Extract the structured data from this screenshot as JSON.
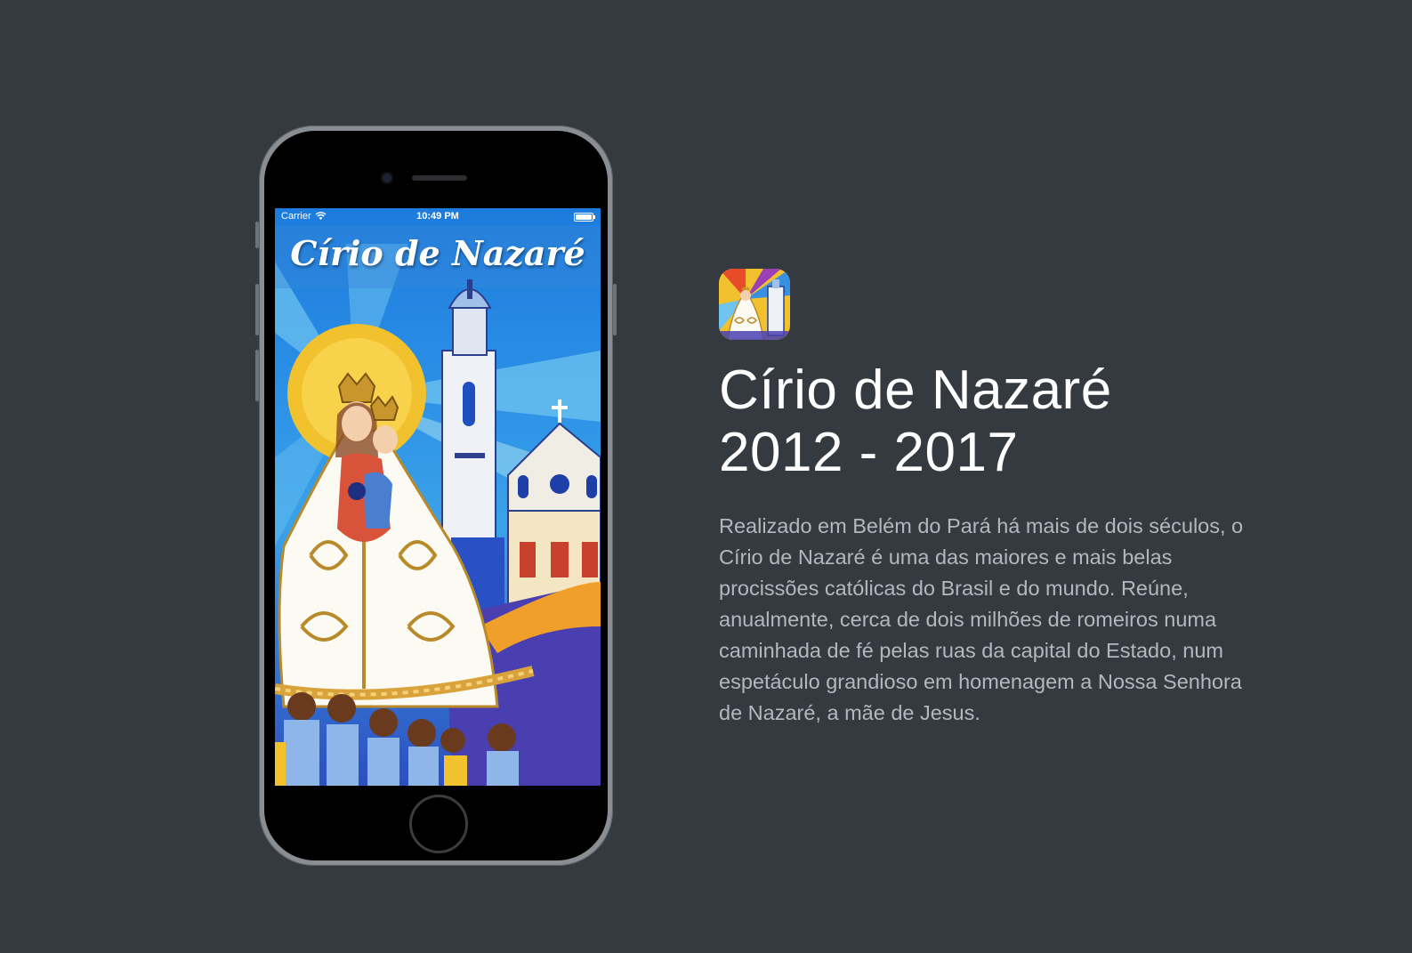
{
  "device": {
    "status_bar": {
      "carrier": "Carrier",
      "time": "10:49 PM"
    },
    "app_title": "Círio de Nazaré"
  },
  "app_icon_name": "cirio-de-nazare-app-icon",
  "heading": {
    "line1": "Círio de Nazaré",
    "line2": "2012 - 2017"
  },
  "description": "Realizado em Belém do Pará há mais de dois séculos, o Círio de Nazaré é uma das maiores e mais belas procissões católicas do Brasil e do mundo. Reúne, anualmente, cerca de dois milhões de romeiros numa caminhada de fé pelas ruas da capital do Estado, num espetáculo grandioso em homenagem a Nossa Senhora de Nazaré, a mãe de Jesus.",
  "colors": {
    "background": "#343a40",
    "screen_blue": "#1c7bdc",
    "heading": "#ffffff",
    "body_text": "#b3b8bf"
  }
}
